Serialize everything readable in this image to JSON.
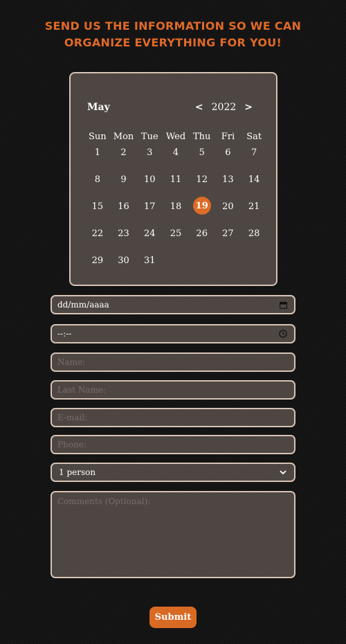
{
  "heading": "SEND US THE INFORMATION SO WE CAN ORGANIZE EVERYTHING FOR YOU!",
  "calendar": {
    "month": "May",
    "year": "2022",
    "prev": "<",
    "next": ">",
    "weekdays": [
      "Sun",
      "Mon",
      "Tue",
      "Wed",
      "Thu",
      "Fri",
      "Sat"
    ],
    "days": [
      "1",
      "2",
      "3",
      "4",
      "5",
      "6",
      "7",
      "8",
      "9",
      "10",
      "11",
      "12",
      "13",
      "14",
      "15",
      "16",
      "17",
      "18",
      "19",
      "20",
      "21",
      "22",
      "23",
      "24",
      "25",
      "26",
      "27",
      "28",
      "29",
      "30",
      "31"
    ],
    "selected": "19"
  },
  "form": {
    "date_placeholder": "dd/mm/aaaa",
    "time_placeholder": "--:--",
    "name_placeholder": "Name:",
    "lastname_placeholder": "Last Name:",
    "email_placeholder": "E-mail:",
    "phone_placeholder": "Phone:",
    "people_selected": "1 person",
    "comments_placeholder": "Comments (Optional):",
    "submit_label": "Submit"
  },
  "colors": {
    "accent": "#dc6c26",
    "field_bg": "#4c4440",
    "border": "#d7c4b6"
  },
  "icons": {
    "date": "calendar-icon",
    "time": "clock-icon",
    "select": "chevron-down-icon"
  }
}
